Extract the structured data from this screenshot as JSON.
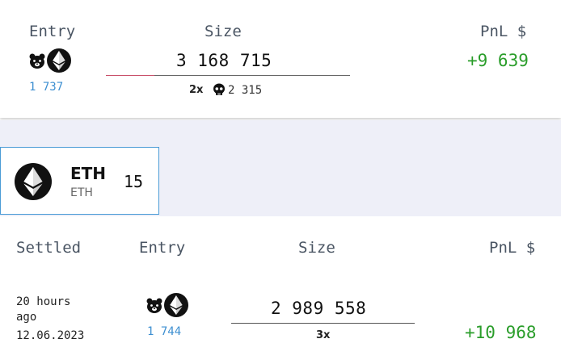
{
  "open_position": {
    "headers": {
      "entry": "Entry",
      "size": "Size",
      "pnl": "PnL $"
    },
    "entry_price": "1 737",
    "size": "3 168 715",
    "leverage": "2x",
    "liquidation_price": "2 315",
    "pnl": "+9 639",
    "direction_icon": "bear-icon",
    "asset_icon": "ethereum-icon"
  },
  "asset_tab": {
    "symbol": "ETH",
    "subtitle": "ETH",
    "count": "15"
  },
  "settled_position": {
    "headers": {
      "settled": "Settled",
      "entry": "Entry",
      "size": "Size",
      "pnl": "PnL $"
    },
    "settled_line1": "20 hours",
    "settled_line2": "ago",
    "settled_date": "12.06.2023",
    "entry_price": "1 744",
    "size": "2 989 558",
    "leverage": "3x",
    "pnl": "+10 968"
  },
  "colors": {
    "profit": "#2a9d2a",
    "entry_price": "#3d8fd1",
    "tab_border": "#4a9bd6",
    "band": "#eeeff8"
  }
}
